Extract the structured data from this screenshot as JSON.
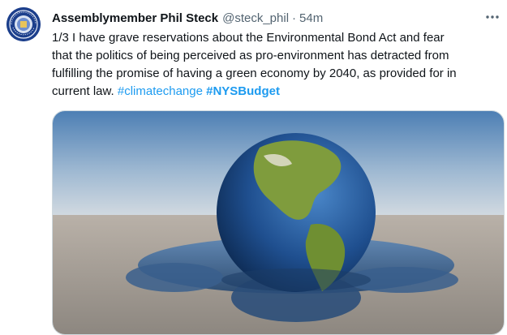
{
  "tweet": {
    "author_name": "Assemblymember Phil Steck",
    "handle": "@steck_phil",
    "separator": "·",
    "time": "54m",
    "more_icon": "more-horizontal-icon",
    "text_line1": "1/3 I have grave reservations about the Environmental Bond Act and fear",
    "text_line2": "that the politics of being perceived as pro-environment has detracted from",
    "text_line3": "fulfilling the promise of having a green economy by 2040, as provided for in",
    "text_line4_prefix": "current law.",
    "hashtag_1": "#climatechange",
    "hashtag_2": "#NYSBudget",
    "image_subject": "melting-earth-globe",
    "colors": {
      "link": "#1d9bf0",
      "secondary_text": "#536471",
      "primary_text": "#0f1419",
      "avatar_blue": "#1c3f8c"
    }
  }
}
